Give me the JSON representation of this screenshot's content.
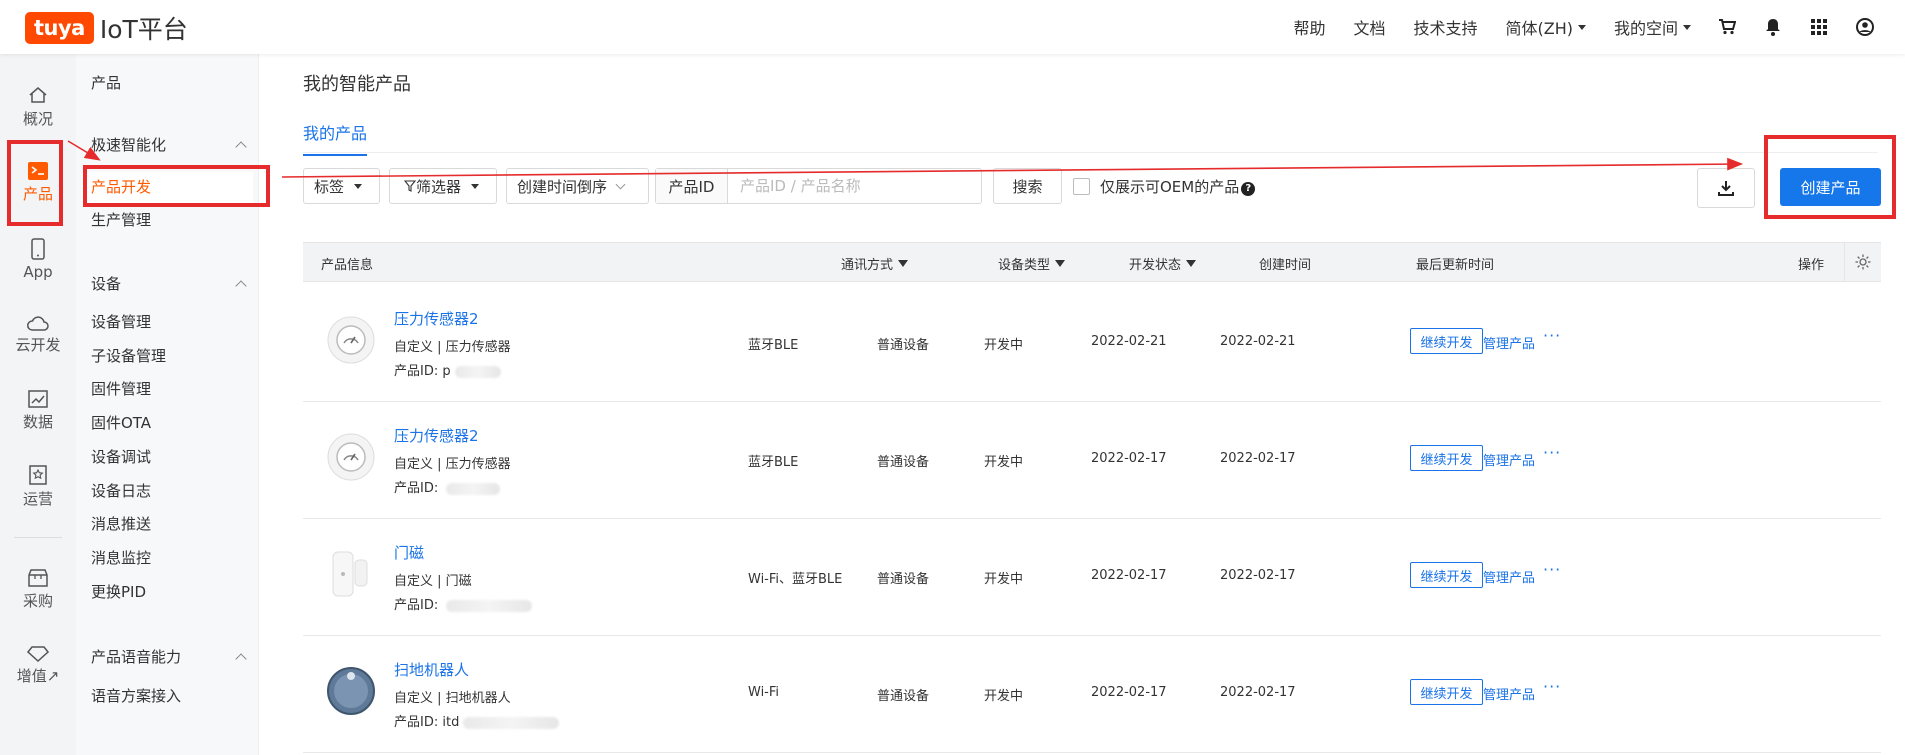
{
  "header": {
    "logo_badge": "tuya",
    "logo_text": "IoT平台",
    "nav": [
      "帮助",
      "文档",
      "技术支持",
      "简体(ZH)",
      "我的空间"
    ]
  },
  "rail": {
    "items": [
      {
        "label": "概况",
        "icon": "home-icon"
      },
      {
        "label": "产品",
        "icon": "terminal-icon"
      },
      {
        "label": "App",
        "icon": "phone-icon"
      },
      {
        "label": "云开发",
        "icon": "cloud-icon"
      },
      {
        "label": "数据",
        "icon": "chart-icon"
      },
      {
        "label": "运营",
        "icon": "star-doc-icon"
      },
      {
        "label": "采购",
        "icon": "store-icon"
      },
      {
        "label": "增值↗",
        "icon": "diamond-icon"
      }
    ]
  },
  "submenu": {
    "title": "产品",
    "group1": "极速智能化",
    "group1_items": [
      "产品开发",
      "生产管理"
    ],
    "group2": "设备",
    "group2_items": [
      "设备管理",
      "子设备管理",
      "固件管理",
      "固件OTA",
      "设备调试",
      "设备日志",
      "消息推送",
      "消息监控",
      "更换PID"
    ],
    "group3": "产品语音能力",
    "group3_items": [
      "语音方案接入"
    ]
  },
  "main": {
    "title": "我的智能产品",
    "tab": "我的产品",
    "toolbar": {
      "tag": "标签",
      "filter": "筛选器",
      "sort": "创建时间倒序",
      "search_prefix": "产品ID",
      "search_placeholder": "产品ID / 产品名称",
      "search_button": "搜索",
      "oem_label": "仅展示可OEM的产品",
      "create_button": "创建产品"
    },
    "columns": {
      "info": "产品信息",
      "comm": "通讯方式",
      "type": "设备类型",
      "status": "开发状态",
      "created": "创建时间",
      "updated": "最后更新时间",
      "ops": "操作"
    },
    "rows": [
      {
        "name": "压力传感器2",
        "meta": "自定义  |  压力传感器",
        "pid_label": "产品ID:",
        "pid": "p",
        "comm": "蓝牙BLE",
        "type": "普通设备",
        "status": "开发中",
        "created": "2022-02-21",
        "updated": "2022-02-21",
        "thumb": "gauge"
      },
      {
        "name": "压力传感器2",
        "meta": "自定义  |  压力传感器",
        "pid_label": "产品ID:",
        "pid": "",
        "comm": "蓝牙BLE",
        "type": "普通设备",
        "status": "开发中",
        "created": "2022-02-17",
        "updated": "2022-02-17",
        "thumb": "gauge"
      },
      {
        "name": "门磁",
        "meta": "自定义  |  门磁",
        "pid_label": "产品ID:",
        "pid": "",
        "comm": "Wi-Fi、蓝牙BLE",
        "type": "普通设备",
        "status": "开发中",
        "created": "2022-02-17",
        "updated": "2022-02-17",
        "thumb": "door"
      },
      {
        "name": "扫地机器人",
        "meta": "自定义  |  扫地机器人",
        "pid_label": "产品ID:",
        "pid": "itd",
        "comm": "Wi-Fi",
        "type": "普通设备",
        "status": "开发中",
        "created": "2022-02-17",
        "updated": "2022-02-17",
        "thumb": "robot"
      }
    ],
    "row_actions": {
      "continue": "继续开发",
      "manage": "管理产品",
      "more": "···"
    }
  },
  "colors": {
    "accent": "#1677ea",
    "active": "#ff5a00",
    "annotation": "#e52b2b"
  }
}
